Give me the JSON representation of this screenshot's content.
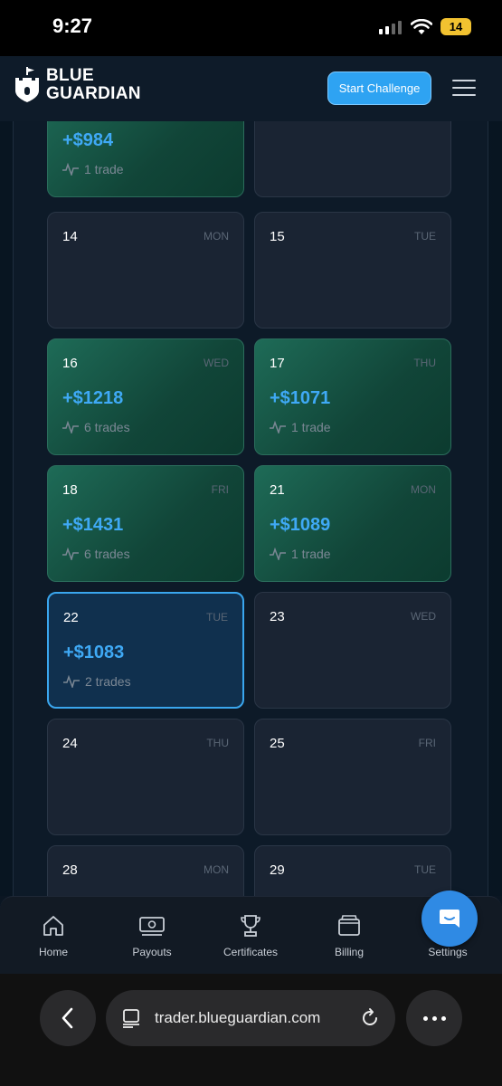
{
  "status": {
    "time": "9:27",
    "battery": "14"
  },
  "header": {
    "brand_line1": "BLUE",
    "brand_line2": "GUARDIAN",
    "start_button": "Start Challenge"
  },
  "days": [
    {
      "num": "",
      "name": "",
      "pnl": "+$984",
      "trades": "1 trade",
      "profit": true
    },
    {
      "num": "",
      "name": "",
      "pnl": "",
      "trades": "",
      "profit": false
    },
    {
      "num": "14",
      "name": "MON",
      "pnl": "",
      "trades": "",
      "profit": false
    },
    {
      "num": "15",
      "name": "TUE",
      "pnl": "",
      "trades": "",
      "profit": false
    },
    {
      "num": "16",
      "name": "WED",
      "pnl": "+$1218",
      "trades": "6 trades",
      "profit": true
    },
    {
      "num": "17",
      "name": "THU",
      "pnl": "+$1071",
      "trades": "1 trade",
      "profit": true
    },
    {
      "num": "18",
      "name": "FRI",
      "pnl": "+$1431",
      "trades": "6 trades",
      "profit": true
    },
    {
      "num": "21",
      "name": "MON",
      "pnl": "+$1089",
      "trades": "1 trade",
      "profit": true
    },
    {
      "num": "22",
      "name": "TUE",
      "pnl": "+$1083",
      "trades": "2 trades",
      "profit": true
    },
    {
      "num": "23",
      "name": "WED",
      "pnl": "",
      "trades": "",
      "profit": false
    },
    {
      "num": "24",
      "name": "THU",
      "pnl": "",
      "trades": "",
      "profit": false
    },
    {
      "num": "25",
      "name": "FRI",
      "pnl": "",
      "trades": "",
      "profit": false
    },
    {
      "num": "28",
      "name": "MON",
      "pnl": "",
      "trades": "",
      "profit": false
    },
    {
      "num": "29",
      "name": "TUE",
      "pnl": "",
      "trades": "",
      "profit": false
    }
  ],
  "nav": {
    "home": "Home",
    "payouts": "Payouts",
    "certificates": "Certificates",
    "billing": "Billing",
    "settings": "Settings"
  },
  "browser": {
    "url": "trader.blueguardian.com"
  },
  "colors": {
    "accent": "#2ea3f2",
    "profit_text": "#3fa9f5",
    "profit_card": "#1e6b57"
  }
}
